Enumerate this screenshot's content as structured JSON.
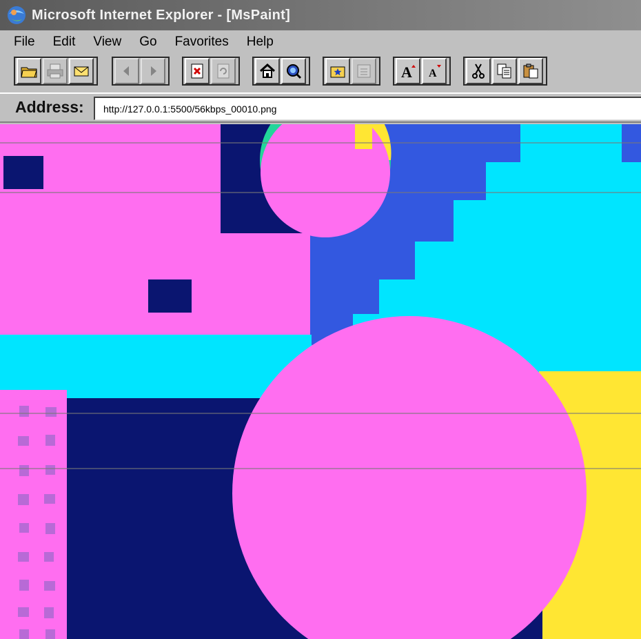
{
  "window": {
    "title": "Microsoft Internet Explorer - [MsPaint]"
  },
  "menu": {
    "items": [
      {
        "label": "File"
      },
      {
        "label": "Edit"
      },
      {
        "label": "View"
      },
      {
        "label": "Go"
      },
      {
        "label": "Favorites"
      },
      {
        "label": "Help"
      }
    ]
  },
  "toolbar": {
    "icons": [
      "open-icon",
      "print-icon",
      "mail-icon",
      "back-icon",
      "forward-icon",
      "stop-icon",
      "refresh-icon",
      "home-icon",
      "search-icon",
      "favorites-icon",
      "history-icon",
      "font-larger-icon",
      "font-smaller-icon",
      "cut-icon",
      "copy-icon",
      "paste-icon"
    ]
  },
  "address": {
    "label": "Address:",
    "url": "http://127.0.0.1:5500/56kbps_00010.png"
  },
  "colors": {
    "pink": "#ff6ef0",
    "navy": "#0a1570",
    "blue": "#3358e0",
    "cyan": "#00e5ff",
    "yellow": "#ffe633",
    "green": "#22d69a"
  }
}
